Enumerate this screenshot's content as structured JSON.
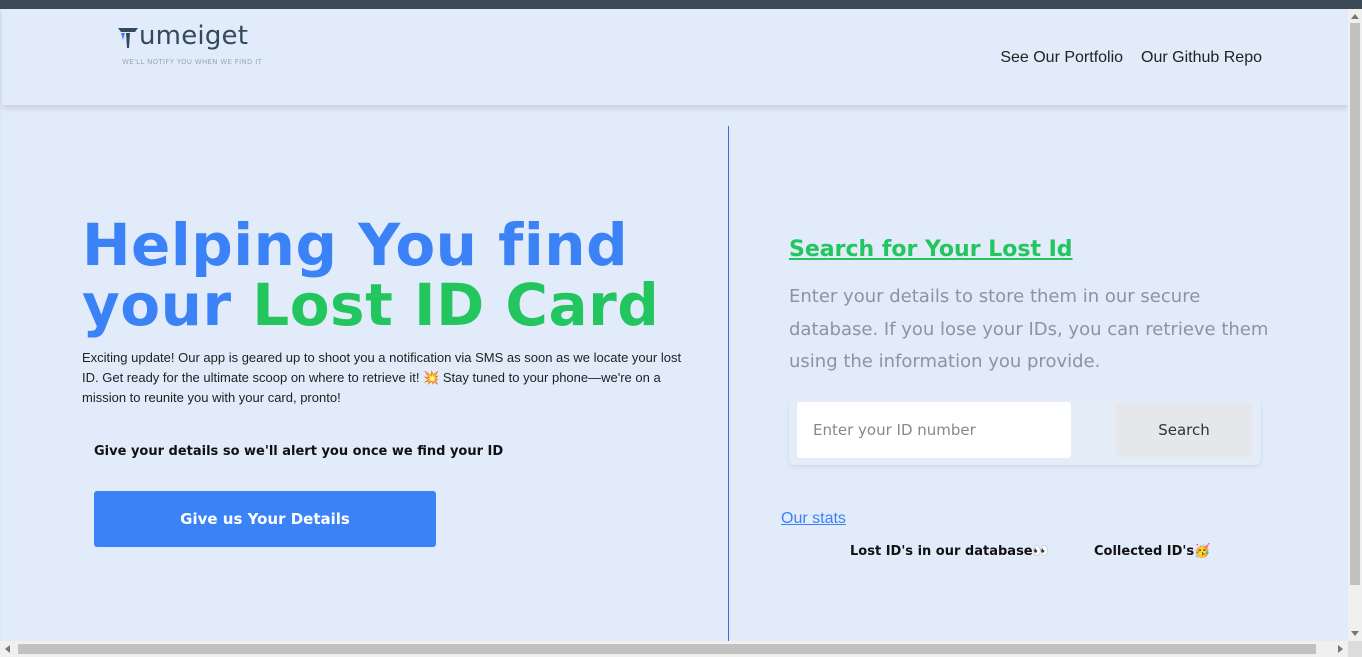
{
  "header": {
    "logo_text": "umeiget",
    "tagline": "WE'LL NOTIFY YOU WHEN WE FIND IT",
    "nav": [
      {
        "label": "See Our Portfolio"
      },
      {
        "label": "Our Github Repo"
      }
    ]
  },
  "hero": {
    "title_line1": "Helping You find",
    "title_line2_a": "your ",
    "title_line2_b": "Lost ID Card",
    "description": "Exciting update! Our app is geared up to shoot you a notification via SMS as soon as we locate your lost ID. Get ready for the ultimate scoop on where to retrieve it! 💥 Stay tuned to your phone—we're on a mission to reunite you with your card, pronto!",
    "alert_text": "Give your details so we'll alert you once we find your ID",
    "cta_label": "Give us Your Details"
  },
  "search": {
    "title": "Search for Your Lost Id",
    "description": "Enter your details to store them in our secure database. If you lose your IDs, you can retrieve them using the information you provide.",
    "placeholder": "Enter your ID number",
    "value": "",
    "button_label": "Search"
  },
  "stats": {
    "link_label": "Our stats",
    "lost_label": "Lost ID's in our database👀",
    "collected_label": "Collected ID's🥳"
  },
  "colors": {
    "accent_blue": "#3b82f6",
    "accent_green": "#22c55e",
    "background": "#e1ebfa"
  }
}
